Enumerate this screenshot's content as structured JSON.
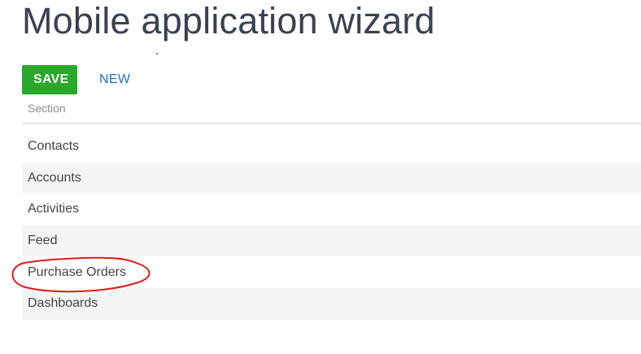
{
  "page": {
    "title": "Mobile application wizard"
  },
  "toolbar": {
    "save_label": "SAVE",
    "new_label": "NEW"
  },
  "grid": {
    "column_header": "Section",
    "rows": [
      {
        "label": "Contacts"
      },
      {
        "label": "Accounts"
      },
      {
        "label": "Activities"
      },
      {
        "label": "Feed"
      },
      {
        "label": "Purchase Orders"
      },
      {
        "label": "Dashboards"
      }
    ]
  },
  "colors": {
    "save_button": "#29a829",
    "link": "#1e6fbf",
    "annotation": "#e21a1a"
  }
}
